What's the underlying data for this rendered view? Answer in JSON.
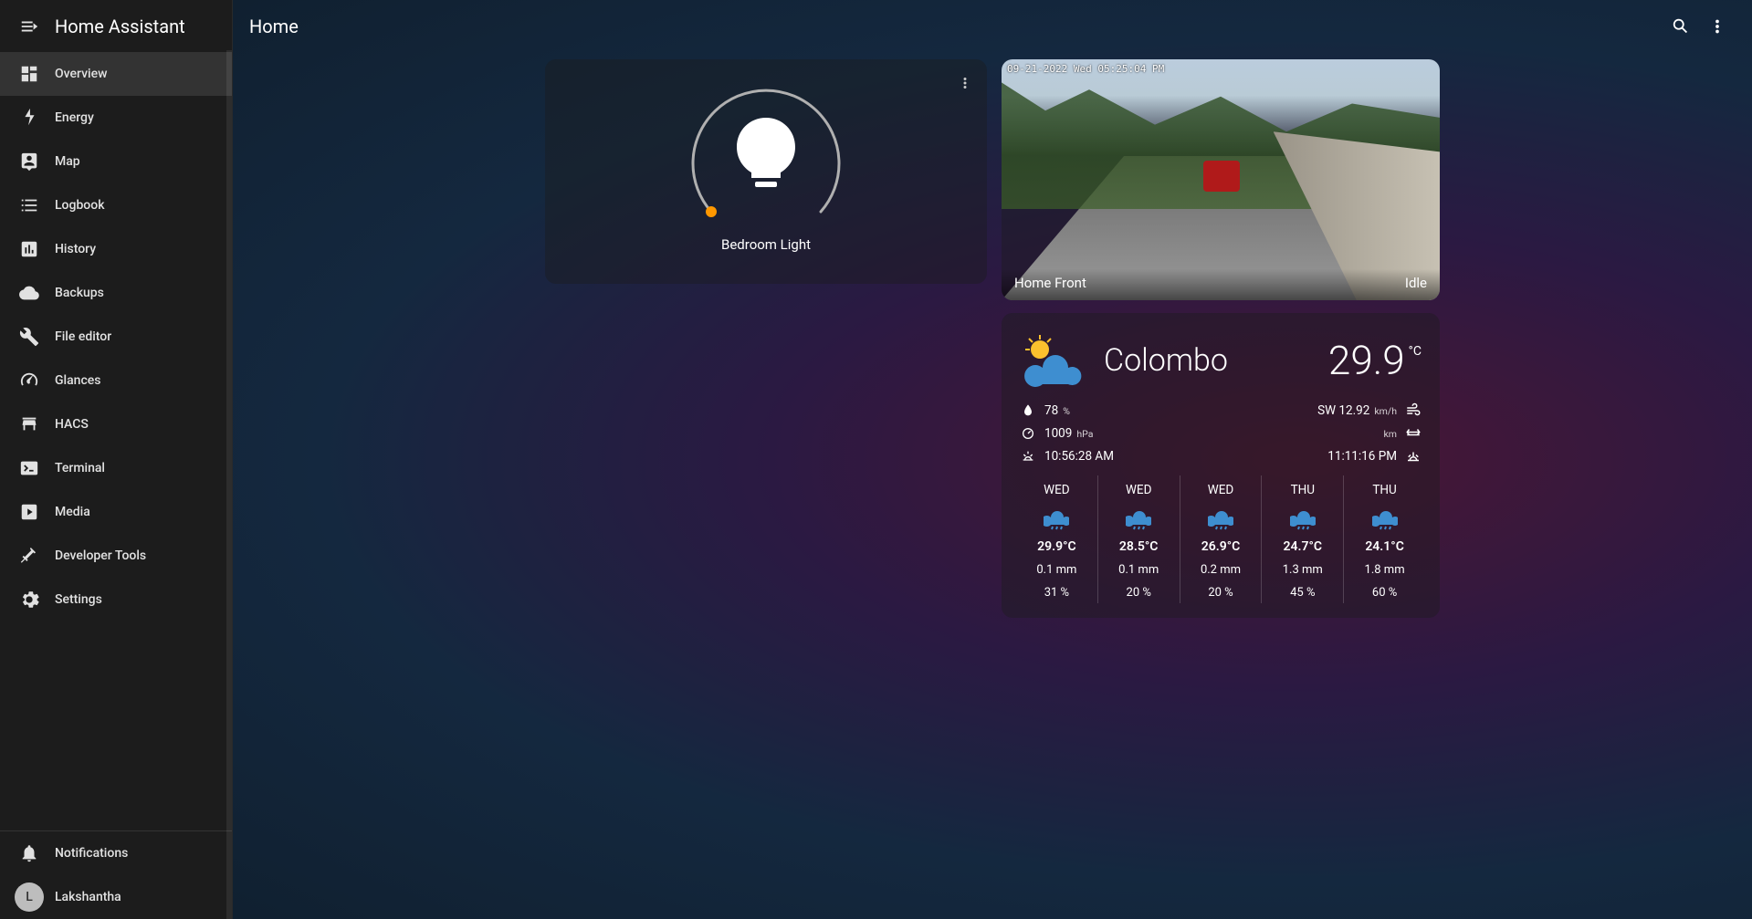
{
  "app_title": "Home Assistant",
  "page_title": "Home",
  "sidebar": {
    "items": [
      {
        "id": "overview",
        "label": "Overview",
        "icon": "dashboard-icon",
        "active": true
      },
      {
        "id": "energy",
        "label": "Energy",
        "icon": "flash-icon"
      },
      {
        "id": "map",
        "label": "Map",
        "icon": "person-pin-icon"
      },
      {
        "id": "logbook",
        "label": "Logbook",
        "icon": "list-icon"
      },
      {
        "id": "history",
        "label": "History",
        "icon": "chart-box-icon"
      },
      {
        "id": "backups",
        "label": "Backups",
        "icon": "cloud-icon"
      },
      {
        "id": "file-editor",
        "label": "File editor",
        "icon": "wrench-icon"
      },
      {
        "id": "glances",
        "label": "Glances",
        "icon": "speedometer-icon"
      },
      {
        "id": "hacs",
        "label": "HACS",
        "icon": "store-icon"
      },
      {
        "id": "terminal",
        "label": "Terminal",
        "icon": "console-icon"
      },
      {
        "id": "media",
        "label": "Media",
        "icon": "play-box-icon"
      },
      {
        "id": "dev-tools",
        "label": "Developer Tools",
        "icon": "hammer-icon"
      },
      {
        "id": "settings",
        "label": "Settings",
        "icon": "cog-icon"
      }
    ],
    "footer": {
      "notifications_label": "Notifications",
      "user_name": "Lakshantha",
      "user_initial": "L"
    }
  },
  "light_card": {
    "name": "Bedroom Light"
  },
  "camera_card": {
    "name": "Home Front",
    "status": "Idle",
    "timestamp": "09-21-2022 Wed 05:25:04 PM"
  },
  "weather": {
    "location": "Colombo",
    "temp": "29.9",
    "temp_unit": "°C",
    "humidity": "78",
    "humidity_unit": "%",
    "pressure": "1009",
    "pressure_unit": "hPa",
    "sunrise": "10:56:28 AM",
    "wind": "SW 12.92",
    "wind_unit": "km/h",
    "visibility_unit": "km",
    "sunset": "11:11:16 PM",
    "forecast": [
      {
        "day": "WED",
        "hi": "29.9°C",
        "precip": "0.1 mm",
        "hum": "31 %"
      },
      {
        "day": "WED",
        "hi": "28.5°C",
        "precip": "0.1 mm",
        "hum": "20 %"
      },
      {
        "day": "WED",
        "hi": "26.9°C",
        "precip": "0.2 mm",
        "hum": "20 %"
      },
      {
        "day": "THU",
        "hi": "24.7°C",
        "precip": "1.3 mm",
        "hum": "45 %"
      },
      {
        "day": "THU",
        "hi": "24.1°C",
        "precip": "1.8 mm",
        "hum": "60 %"
      }
    ]
  }
}
